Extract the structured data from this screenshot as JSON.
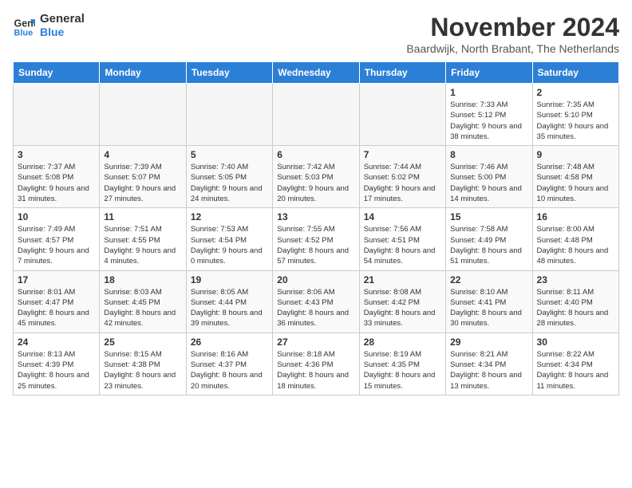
{
  "header": {
    "logo_line1": "General",
    "logo_line2": "Blue",
    "month": "November 2024",
    "location": "Baardwijk, North Brabant, The Netherlands"
  },
  "columns": [
    "Sunday",
    "Monday",
    "Tuesday",
    "Wednesday",
    "Thursday",
    "Friday",
    "Saturday"
  ],
  "weeks": [
    [
      {
        "day": "",
        "empty": true
      },
      {
        "day": "",
        "empty": true
      },
      {
        "day": "",
        "empty": true
      },
      {
        "day": "",
        "empty": true
      },
      {
        "day": "",
        "empty": true
      },
      {
        "day": "1",
        "sunrise": "Sunrise: 7:33 AM",
        "sunset": "Sunset: 5:12 PM",
        "daylight": "Daylight: 9 hours and 38 minutes."
      },
      {
        "day": "2",
        "sunrise": "Sunrise: 7:35 AM",
        "sunset": "Sunset: 5:10 PM",
        "daylight": "Daylight: 9 hours and 35 minutes."
      }
    ],
    [
      {
        "day": "3",
        "sunrise": "Sunrise: 7:37 AM",
        "sunset": "Sunset: 5:08 PM",
        "daylight": "Daylight: 9 hours and 31 minutes."
      },
      {
        "day": "4",
        "sunrise": "Sunrise: 7:39 AM",
        "sunset": "Sunset: 5:07 PM",
        "daylight": "Daylight: 9 hours and 27 minutes."
      },
      {
        "day": "5",
        "sunrise": "Sunrise: 7:40 AM",
        "sunset": "Sunset: 5:05 PM",
        "daylight": "Daylight: 9 hours and 24 minutes."
      },
      {
        "day": "6",
        "sunrise": "Sunrise: 7:42 AM",
        "sunset": "Sunset: 5:03 PM",
        "daylight": "Daylight: 9 hours and 20 minutes."
      },
      {
        "day": "7",
        "sunrise": "Sunrise: 7:44 AM",
        "sunset": "Sunset: 5:02 PM",
        "daylight": "Daylight: 9 hours and 17 minutes."
      },
      {
        "day": "8",
        "sunrise": "Sunrise: 7:46 AM",
        "sunset": "Sunset: 5:00 PM",
        "daylight": "Daylight: 9 hours and 14 minutes."
      },
      {
        "day": "9",
        "sunrise": "Sunrise: 7:48 AM",
        "sunset": "Sunset: 4:58 PM",
        "daylight": "Daylight: 9 hours and 10 minutes."
      }
    ],
    [
      {
        "day": "10",
        "sunrise": "Sunrise: 7:49 AM",
        "sunset": "Sunset: 4:57 PM",
        "daylight": "Daylight: 9 hours and 7 minutes."
      },
      {
        "day": "11",
        "sunrise": "Sunrise: 7:51 AM",
        "sunset": "Sunset: 4:55 PM",
        "daylight": "Daylight: 9 hours and 4 minutes."
      },
      {
        "day": "12",
        "sunrise": "Sunrise: 7:53 AM",
        "sunset": "Sunset: 4:54 PM",
        "daylight": "Daylight: 9 hours and 0 minutes."
      },
      {
        "day": "13",
        "sunrise": "Sunrise: 7:55 AM",
        "sunset": "Sunset: 4:52 PM",
        "daylight": "Daylight: 8 hours and 57 minutes."
      },
      {
        "day": "14",
        "sunrise": "Sunrise: 7:56 AM",
        "sunset": "Sunset: 4:51 PM",
        "daylight": "Daylight: 8 hours and 54 minutes."
      },
      {
        "day": "15",
        "sunrise": "Sunrise: 7:58 AM",
        "sunset": "Sunset: 4:49 PM",
        "daylight": "Daylight: 8 hours and 51 minutes."
      },
      {
        "day": "16",
        "sunrise": "Sunrise: 8:00 AM",
        "sunset": "Sunset: 4:48 PM",
        "daylight": "Daylight: 8 hours and 48 minutes."
      }
    ],
    [
      {
        "day": "17",
        "sunrise": "Sunrise: 8:01 AM",
        "sunset": "Sunset: 4:47 PM",
        "daylight": "Daylight: 8 hours and 45 minutes."
      },
      {
        "day": "18",
        "sunrise": "Sunrise: 8:03 AM",
        "sunset": "Sunset: 4:45 PM",
        "daylight": "Daylight: 8 hours and 42 minutes."
      },
      {
        "day": "19",
        "sunrise": "Sunrise: 8:05 AM",
        "sunset": "Sunset: 4:44 PM",
        "daylight": "Daylight: 8 hours and 39 minutes."
      },
      {
        "day": "20",
        "sunrise": "Sunrise: 8:06 AM",
        "sunset": "Sunset: 4:43 PM",
        "daylight": "Daylight: 8 hours and 36 minutes."
      },
      {
        "day": "21",
        "sunrise": "Sunrise: 8:08 AM",
        "sunset": "Sunset: 4:42 PM",
        "daylight": "Daylight: 8 hours and 33 minutes."
      },
      {
        "day": "22",
        "sunrise": "Sunrise: 8:10 AM",
        "sunset": "Sunset: 4:41 PM",
        "daylight": "Daylight: 8 hours and 30 minutes."
      },
      {
        "day": "23",
        "sunrise": "Sunrise: 8:11 AM",
        "sunset": "Sunset: 4:40 PM",
        "daylight": "Daylight: 8 hours and 28 minutes."
      }
    ],
    [
      {
        "day": "24",
        "sunrise": "Sunrise: 8:13 AM",
        "sunset": "Sunset: 4:39 PM",
        "daylight": "Daylight: 8 hours and 25 minutes."
      },
      {
        "day": "25",
        "sunrise": "Sunrise: 8:15 AM",
        "sunset": "Sunset: 4:38 PM",
        "daylight": "Daylight: 8 hours and 23 minutes."
      },
      {
        "day": "26",
        "sunrise": "Sunrise: 8:16 AM",
        "sunset": "Sunset: 4:37 PM",
        "daylight": "Daylight: 8 hours and 20 minutes."
      },
      {
        "day": "27",
        "sunrise": "Sunrise: 8:18 AM",
        "sunset": "Sunset: 4:36 PM",
        "daylight": "Daylight: 8 hours and 18 minutes."
      },
      {
        "day": "28",
        "sunrise": "Sunrise: 8:19 AM",
        "sunset": "Sunset: 4:35 PM",
        "daylight": "Daylight: 8 hours and 15 minutes."
      },
      {
        "day": "29",
        "sunrise": "Sunrise: 8:21 AM",
        "sunset": "Sunset: 4:34 PM",
        "daylight": "Daylight: 8 hours and 13 minutes."
      },
      {
        "day": "30",
        "sunrise": "Sunrise: 8:22 AM",
        "sunset": "Sunset: 4:34 PM",
        "daylight": "Daylight: 8 hours and 11 minutes."
      }
    ]
  ]
}
